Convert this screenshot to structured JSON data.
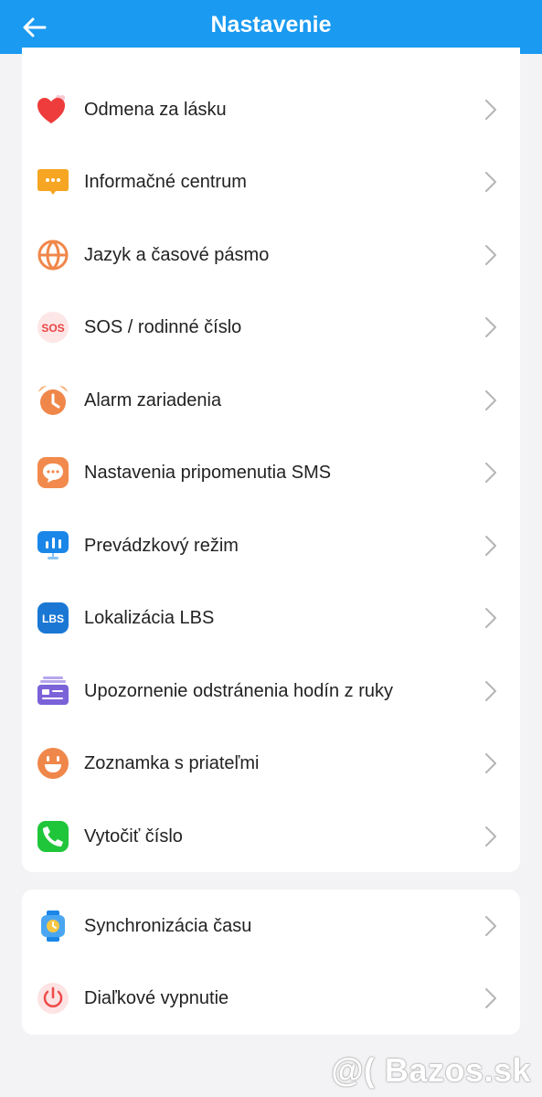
{
  "header": {
    "title": "Nastavenie",
    "back_icon": "arrow-left-icon",
    "background": "#1a9af0"
  },
  "group1": [
    {
      "id": "odmena",
      "label": "Odmena za lásku",
      "icon": "heart-icon"
    },
    {
      "id": "info",
      "label": "Informačné centrum",
      "icon": "message-dots-icon"
    },
    {
      "id": "jazyk",
      "label": "Jazyk a časové pásmo",
      "icon": "globe-icon"
    },
    {
      "id": "sos",
      "label": "SOS / rodinné číslo",
      "icon": "sos-icon"
    },
    {
      "id": "alarm",
      "label": "Alarm zariadenia",
      "icon": "alarm-clock-icon"
    },
    {
      "id": "sms",
      "label": "Nastavenia pripomenutia SMS",
      "icon": "chat-bubble-icon"
    },
    {
      "id": "rezim",
      "label": "Prevádzkový režim",
      "icon": "monitor-chart-icon"
    },
    {
      "id": "lbs",
      "label": "Lokalizácia LBS",
      "icon": "lbs-icon"
    },
    {
      "id": "upozornenie",
      "label": "Upozornenie odstránenia hodín z ruky",
      "icon": "id-card-icon"
    },
    {
      "id": "zoznamka",
      "label": "Zoznamka s priateľmi",
      "icon": "smiley-icon"
    },
    {
      "id": "vytocit",
      "label": "Vytočiť číslo",
      "icon": "phone-icon"
    }
  ],
  "group2": [
    {
      "id": "sync",
      "label": "Synchronizácia času",
      "icon": "watch-icon"
    },
    {
      "id": "vypnutie",
      "label": "Diaľkové vypnutie",
      "icon": "power-icon"
    }
  ],
  "watermark": "@( Bazos.sk"
}
